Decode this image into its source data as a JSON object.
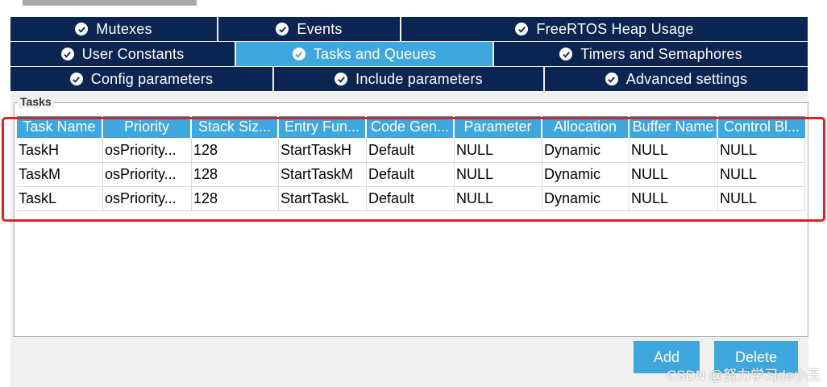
{
  "tabs": {
    "row1": [
      "Mutexes",
      "Events",
      "FreeRTOS Heap Usage"
    ],
    "row2": [
      "User Constants",
      "Tasks and Queues",
      "Timers and Semaphores"
    ],
    "row3": [
      "Config parameters",
      "Include parameters",
      "Advanced settings"
    ],
    "active": "Tasks and Queues"
  },
  "tasks_section": {
    "legend": "Tasks",
    "columns": [
      "Task Name",
      "Priority",
      "Stack Siz...",
      "Entry Fun...",
      "Code Gen...",
      "Parameter",
      "Allocation",
      "Buffer Name",
      "Control Bl..."
    ],
    "rows": [
      [
        "TaskH",
        "osPriority...",
        "128",
        "StartTaskH",
        "Default",
        "NULL",
        "Dynamic",
        "NULL",
        "NULL"
      ],
      [
        "TaskM",
        "osPriority...",
        "128",
        "StartTaskM",
        "Default",
        "NULL",
        "Dynamic",
        "NULL",
        "NULL"
      ],
      [
        "TaskL",
        "osPriority...",
        "128",
        "StartTaskL",
        "Default",
        "NULL",
        "Dynamic",
        "NULL",
        "NULL"
      ]
    ]
  },
  "buttons": {
    "add": "Add",
    "delete": "Delete"
  },
  "watermark": "CSDN @努力学习de小王",
  "colors": {
    "tab_dark": "#0b2552",
    "accent": "#3ea7dd",
    "highlight": "#e02020"
  }
}
